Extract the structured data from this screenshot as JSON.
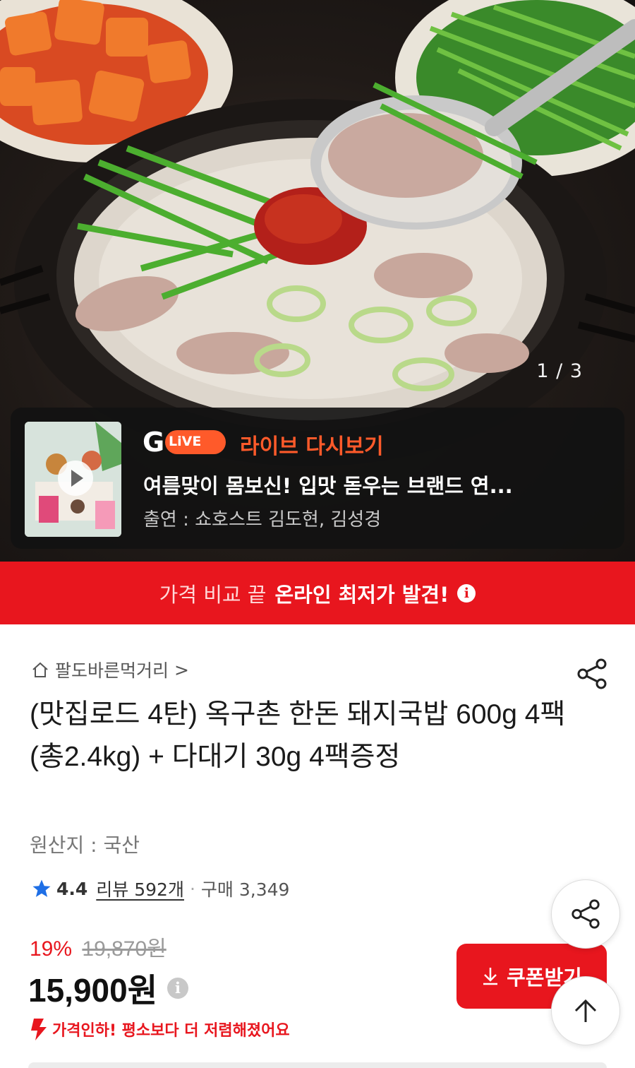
{
  "gallery": {
    "counter": "1 / 3"
  },
  "live": {
    "badge": "LiVE",
    "title": "라이브 다시보기",
    "description": "여름맞이 몸보신! 입맛 돋우는 브랜드 연...",
    "cast": "출연 : 쇼호스트 김도현, 김성경"
  },
  "banner": {
    "normal": "가격 비교 끝",
    "strong": "온라인 최저가 발견!",
    "info": "i"
  },
  "seller": {
    "name": "팔도바른먹거리",
    "chevron": ">"
  },
  "product": {
    "title": "(맛집로드 4탄) 옥구촌 한돈 돼지국밥 600g 4팩 (총2.4kg) + 다대기 30g 4팩증정",
    "origin": "원산지 : 국산"
  },
  "rating": {
    "score": "4.4",
    "review": "리뷰 592개",
    "separator": "·",
    "purchases": "구매 3,349"
  },
  "price": {
    "discount": "19%",
    "original": "19,870원",
    "final": "15,900원",
    "info": "i",
    "notice": "가격인하! 평소보다 더 저렴해졌어요"
  },
  "coupon": {
    "label": "쿠폰받기"
  },
  "colors": {
    "accent": "#e8161e",
    "live_orange": "#ff5a2a",
    "star_blue": "#1e6fe6"
  },
  "icons": {
    "home": "home-icon",
    "share": "share-icon",
    "star": "star-icon",
    "download": "download-icon",
    "arrow_up": "arrow-up-icon",
    "price_down": "price-down-icon",
    "play": "play-icon"
  }
}
